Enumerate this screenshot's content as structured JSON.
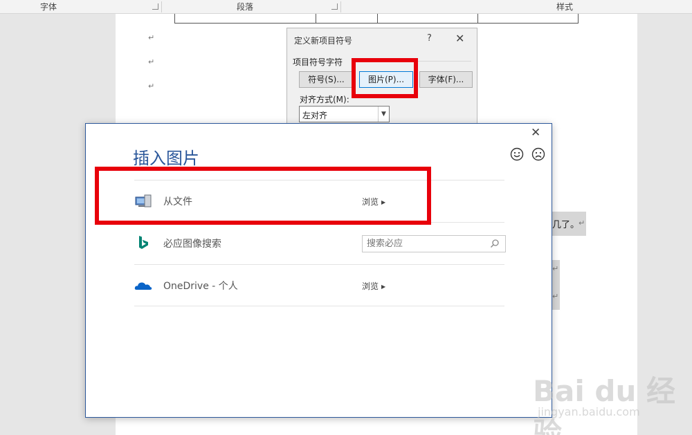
{
  "ribbon": {
    "font_group": "字体",
    "paragraph_group": "段落",
    "styles_group": "样式"
  },
  "document": {
    "paragraph_mark": "↵",
    "highlighted_text": "几了。"
  },
  "bullet_dialog": {
    "title": "定义新项目符号",
    "help": "?",
    "close": "✕",
    "group_label": "项目符号字符",
    "symbol_button": "符号(S)...",
    "picture_button": "图片(P)...",
    "font_button": "字体(F)...",
    "alignment_label": "对齐方式(M):",
    "alignment_value": "左对齐"
  },
  "insert_picture": {
    "title": "插入图片",
    "close": "✕",
    "rows": [
      {
        "label": "从文件",
        "action": "浏览",
        "icon": "computer-icon"
      },
      {
        "label": "必应图像搜索",
        "search_placeholder": "搜索必应",
        "icon": "bing-icon"
      },
      {
        "label": "OneDrive - 个人",
        "action": "浏览",
        "icon": "onedrive-icon"
      }
    ]
  },
  "watermark": {
    "main": "Bai du 经验",
    "sub": "jingyan.baidu.com"
  },
  "colors": {
    "accent": "#2b579a",
    "annotation_red": "#e8000b",
    "bing_teal": "#008373",
    "onedrive_blue": "#0a64c8"
  }
}
